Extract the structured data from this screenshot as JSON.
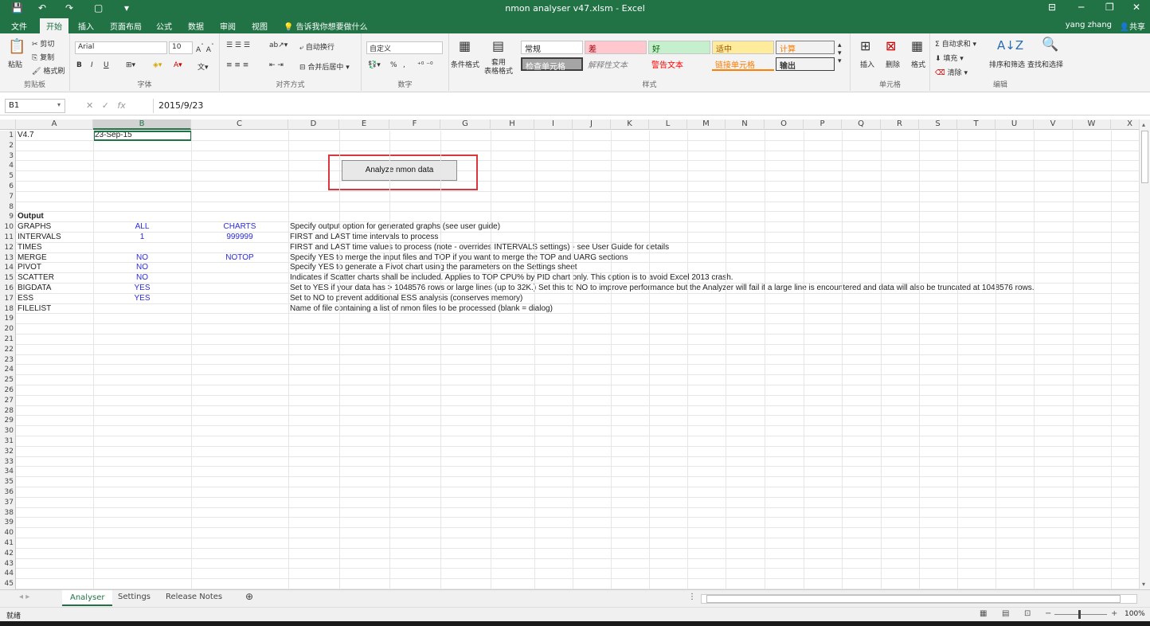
{
  "window": {
    "title": "nmon analyser v47.xlsm - Excel",
    "user": "yang zhang",
    "share": "共享"
  },
  "menu": [
    "文件",
    "开始",
    "插入",
    "页面布局",
    "公式",
    "数据",
    "审阅",
    "视图"
  ],
  "tellme": "告诉我你想要做什么",
  "ribbon": {
    "clipboard": {
      "paste": "粘贴",
      "cut": "剪切",
      "copy": "复制",
      "format_painter": "格式刷",
      "label": "剪贴板"
    },
    "font": {
      "name": "Arial",
      "size": "10",
      "label": "字体",
      "bold": "B",
      "italic": "I",
      "underline": "U"
    },
    "align": {
      "wrap": "自动换行",
      "merge": "合并后居中",
      "label": "对齐方式"
    },
    "number": {
      "format": "自定义",
      "percent": "%",
      "comma": ",",
      "label": "数字"
    },
    "styles": {
      "cond": "条件格式",
      "table": "套用\n表格格式",
      "label": "样式",
      "cells": [
        "常规",
        "差",
        "好",
        "适中",
        "计算",
        "检查单元格",
        "解释性文本",
        "警告文本",
        "链接单元格",
        "输出"
      ]
    },
    "cells": {
      "insert": "插入",
      "delete": "删除",
      "format": "格式",
      "label": "单元格"
    },
    "edit": {
      "autosum": "自动求和",
      "fill": "填充",
      "clear": "清除",
      "sort": "排序和筛选",
      "find": "查找和选择",
      "label": "编辑"
    }
  },
  "formula_bar": {
    "cell": "B1",
    "value": "2015/9/23"
  },
  "columns": [
    "A",
    "B",
    "C",
    "D",
    "E",
    "F",
    "G",
    "H",
    "I",
    "J",
    "K",
    "L",
    "M",
    "N",
    "O",
    "P",
    "Q",
    "R",
    "S",
    "T",
    "U",
    "V",
    "W",
    "X"
  ],
  "button_label": "Analyze nmon data",
  "cells": {
    "r1": {
      "a": "V4.7",
      "b": "23-Sep-15"
    },
    "r9": {
      "a": "Output"
    },
    "r10": {
      "a": "GRAPHS",
      "b": "ALL",
      "c": "CHARTS",
      "d": "Specify output option for generated graphs (see user guide)"
    },
    "r11": {
      "a": "INTERVALS",
      "b": "1",
      "c": "999999",
      "d": "FIRST and LAST time intervals to process"
    },
    "r12": {
      "a": "TIMES",
      "d": "FIRST and LAST time values to process (note - overrides INTERVALS settings) - see User Guide for details"
    },
    "r13": {
      "a": "MERGE",
      "b": "NO",
      "c": "NOTOP",
      "d": "Specify YES to merge the input files and TOP if you want to merge the TOP and UARG sections"
    },
    "r14": {
      "a": "PIVOT",
      "b": "NO",
      "d": "Specify YES to generate a Pivot chart using the parameters on the Settings sheet"
    },
    "r15": {
      "a": "SCATTER",
      "b": "NO",
      "d": "Indicates if Scatter charts shall be included.  Applies to TOP CPU% by PID chart only.  This option is to avoid Excel 2013 crash."
    },
    "r16": {
      "a": "BIGDATA",
      "b": "YES",
      "d": "Set to YES if your data has > 1048576 rows or large lines (up to 32K.)  Set this to NO to improve performance but the Analyzer will fail if a large line is encountered and data will also be truncated at 1048576 rows."
    },
    "r17": {
      "a": "ESS",
      "b": "YES",
      "d": "Set to NO to prevent additional ESS analysis (conserves memory)"
    },
    "r18": {
      "a": "FILELIST",
      "d": "Name of file containing a list of nmon files to be processed (blank = dialog)"
    }
  },
  "sheets": [
    "Analyser",
    "Settings",
    "Release Notes"
  ],
  "status": {
    "ready": "就绪",
    "zoom": "100%"
  }
}
